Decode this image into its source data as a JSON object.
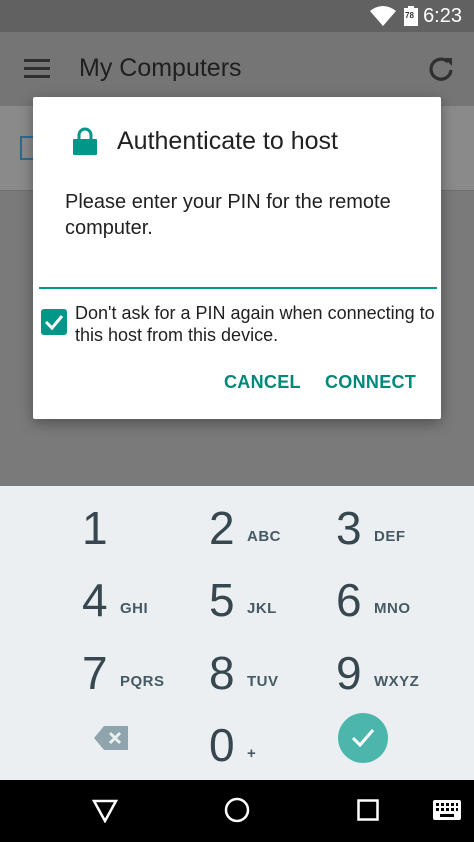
{
  "status_bar": {
    "time": "6:23",
    "battery_level": "78",
    "wifi_icon": "wifi-icon",
    "battery_icon": "battery-icon"
  },
  "app_bar": {
    "title": "My Computers",
    "menu_icon": "hamburger-menu-icon",
    "refresh_icon": "refresh-icon"
  },
  "dialog": {
    "title": "Authenticate to host",
    "message": "Please enter your PIN for the remote computer.",
    "pin_value": "",
    "checkbox_checked": true,
    "checkbox_label": "Don't ask for a PIN again when connecting to this host from this device.",
    "cancel_label": "CANCEL",
    "connect_label": "CONNECT",
    "accent_color": "#009688"
  },
  "keypad": {
    "keys": [
      {
        "digit": "1",
        "letters": ""
      },
      {
        "digit": "2",
        "letters": "ABC"
      },
      {
        "digit": "3",
        "letters": "DEF"
      },
      {
        "digit": "4",
        "letters": "GHI"
      },
      {
        "digit": "5",
        "letters": "JKL"
      },
      {
        "digit": "6",
        "letters": "MNO"
      },
      {
        "digit": "7",
        "letters": "PQRS"
      },
      {
        "digit": "8",
        "letters": "TUV"
      },
      {
        "digit": "9",
        "letters": "WXYZ"
      },
      {
        "digit": "0",
        "letters": "+"
      }
    ],
    "backspace_icon": "backspace-icon",
    "enter_icon": "checkmark-icon"
  },
  "nav_bar": {
    "back_icon": "back-triangle-icon",
    "home_icon": "home-circle-icon",
    "recents_icon": "recents-square-icon",
    "keyboard_icon": "keyboard-icon"
  }
}
